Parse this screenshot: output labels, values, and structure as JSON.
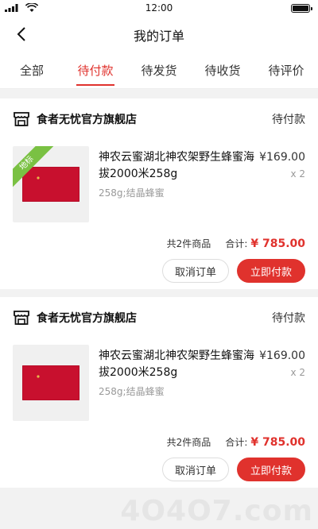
{
  "status_bar": {
    "time": "12:00"
  },
  "nav": {
    "title": "我的订单"
  },
  "tabs": [
    {
      "label": "全部"
    },
    {
      "label": "待付款",
      "active": true
    },
    {
      "label": "待发货"
    },
    {
      "label": "待收货"
    },
    {
      "label": "待评价"
    }
  ],
  "orders": [
    {
      "shop_name": "食者无忧官方旗舰店",
      "status": "待付款",
      "product": {
        "tag": "地标",
        "title": "神农云蜜湖北神农架野生蜂蜜海拔2000米258g",
        "spec": "258g;结晶蜂蜜",
        "price": "¥169.00",
        "qty": "x 2"
      },
      "count_text": "共2件商品",
      "total_label": "合计:",
      "total": "¥ 785.00",
      "cancel_label": "取消订单",
      "pay_label": "立即付款"
    },
    {
      "shop_name": "食者无忧官方旗舰店",
      "status": "待付款",
      "product": {
        "title": "神农云蜜湖北神农架野生蜂蜜海拔2000米258g",
        "spec": "258g;结晶蜂蜜",
        "price": "¥169.00",
        "qty": "x 2"
      },
      "count_text": "共2件商品",
      "total_label": "合计:",
      "total": "¥ 785.00",
      "cancel_label": "取消订单",
      "pay_label": "立即付款"
    }
  ],
  "watermark": "4O4O7.com",
  "colors": {
    "accent": "#e0322d",
    "tag": "#7ac143"
  },
  "icons": [
    "signal-icon",
    "wifi-icon",
    "battery-icon",
    "back-arrow-icon",
    "store-icon"
  ]
}
